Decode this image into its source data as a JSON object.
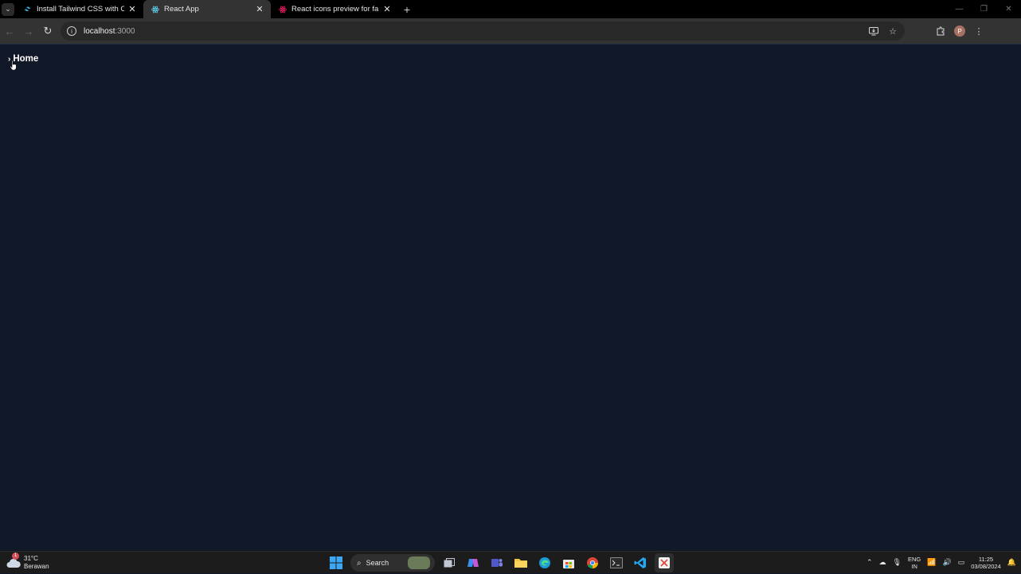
{
  "browser": {
    "tabs": [
      {
        "title": "Install Tailwind CSS with Create",
        "favicon": "tailwind-icon",
        "color": "#38bdf8",
        "active": false
      },
      {
        "title": "React App",
        "favicon": "react-icon",
        "color": "#61dafb",
        "active": true
      },
      {
        "title": "React icons preview for fa",
        "favicon": "react-icons-icon",
        "color": "#e91e63",
        "active": false
      }
    ],
    "new_tab_label": "+",
    "url_host": "localhost",
    "url_port": ":3000",
    "profile_initial": "P"
  },
  "page": {
    "home_label": "Home",
    "background": "#111827"
  },
  "taskbar": {
    "weather_temp": "31°C",
    "weather_desc": "Berawan",
    "weather_badge": "1",
    "search_label": "Search",
    "lang_top": "ENG",
    "lang_bottom": "IN",
    "time": "11:25",
    "date": "03/08/2024"
  }
}
